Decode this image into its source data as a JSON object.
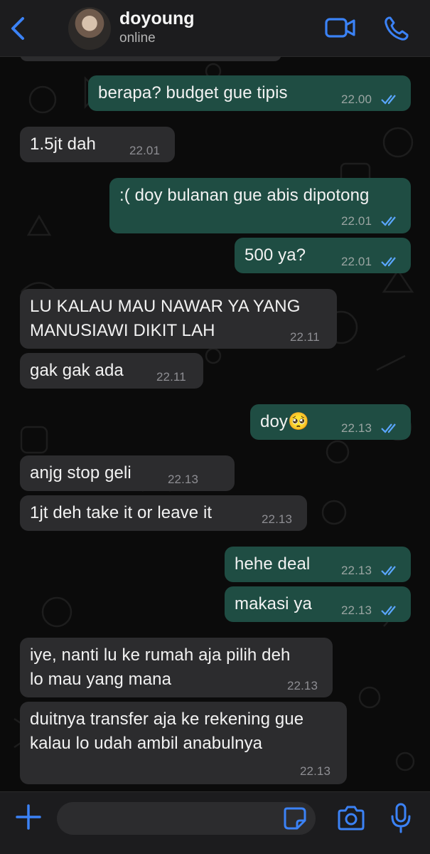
{
  "header": {
    "contact_name": "doyoung",
    "status": "online",
    "icons": [
      "chevron-left-icon",
      "video-call-icon",
      "phone-icon"
    ],
    "accent_color": "#3b82f6"
  },
  "messages": [
    {
      "direction": "out",
      "text": "berapa? budget gue tipis",
      "time": "22.00",
      "read": true
    },
    {
      "direction": "in",
      "text": "1.5jt dah",
      "time": "22.01"
    },
    {
      "direction": "out",
      "text": ":( doy bulanan gue abis dipotong",
      "time": "22.01",
      "read": true
    },
    {
      "direction": "out",
      "text": "500 ya?",
      "time": "22.01",
      "read": true
    },
    {
      "direction": "in",
      "text": "LU KALAU MAU NAWAR YA YANG\nMANUSIAWI DIKIT LAH",
      "time": "22.11"
    },
    {
      "direction": "in",
      "text": "gak gak ada",
      "time": "22.11"
    },
    {
      "direction": "out",
      "text": "doy🥺",
      "time": "22.13",
      "read": true
    },
    {
      "direction": "in",
      "text": "anjg stop geli",
      "time": "22.13"
    },
    {
      "direction": "in",
      "text": "1jt deh take it or leave it",
      "time": "22.13"
    },
    {
      "direction": "out",
      "text": "hehe deal",
      "time": "22.13",
      "read": true
    },
    {
      "direction": "out",
      "text": "makasi ya",
      "time": "22.13",
      "read": true
    },
    {
      "direction": "in",
      "text": "iye, nanti lu ke rumah aja pilih deh\nlo mau yang mana",
      "time": "22.13"
    },
    {
      "direction": "in",
      "text": "duitnya transfer aja ke rekening gue\nkalau lo udah ambil anabulnya",
      "time": "22.13"
    }
  ],
  "input_bar": {
    "placeholder": "",
    "icons": [
      "plus-icon",
      "sticker-icon",
      "camera-icon",
      "microphone-icon"
    ]
  },
  "colors": {
    "outgoing_bubble": "#1f4d43",
    "incoming_bubble": "#2c2c2e",
    "read_ticks": "#5aa6ff"
  }
}
